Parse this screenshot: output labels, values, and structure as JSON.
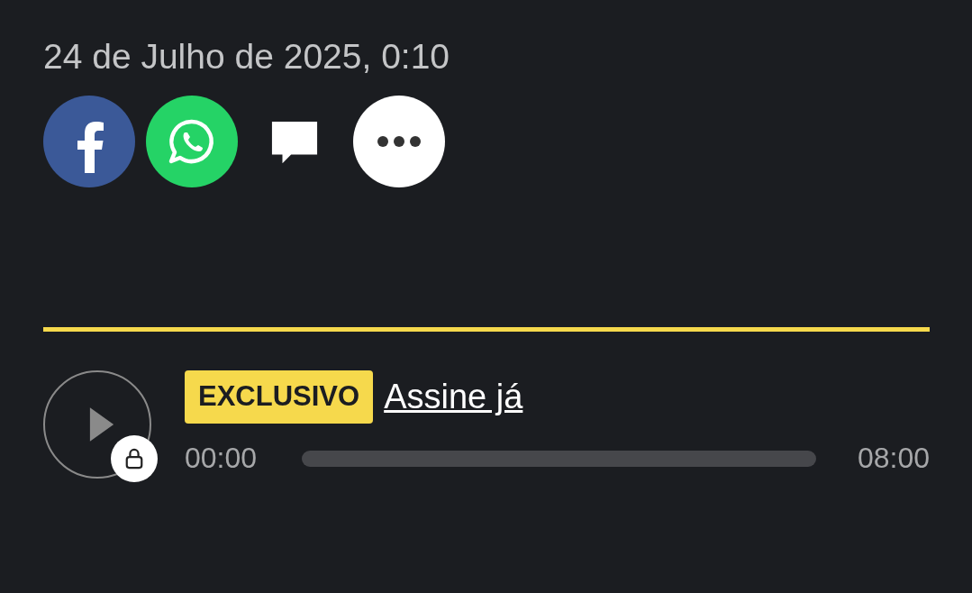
{
  "article": {
    "date": "24 de Julho de 2025, 0:10"
  },
  "share_buttons": [
    {
      "kind": "facebook"
    },
    {
      "kind": "whatsapp"
    },
    {
      "kind": "comment"
    },
    {
      "kind": "more"
    }
  ],
  "audio_player": {
    "locked": true,
    "badge": "EXCLUSIVO",
    "link": "Assine já",
    "current_time": "00:00",
    "duration": "08:00"
  }
}
